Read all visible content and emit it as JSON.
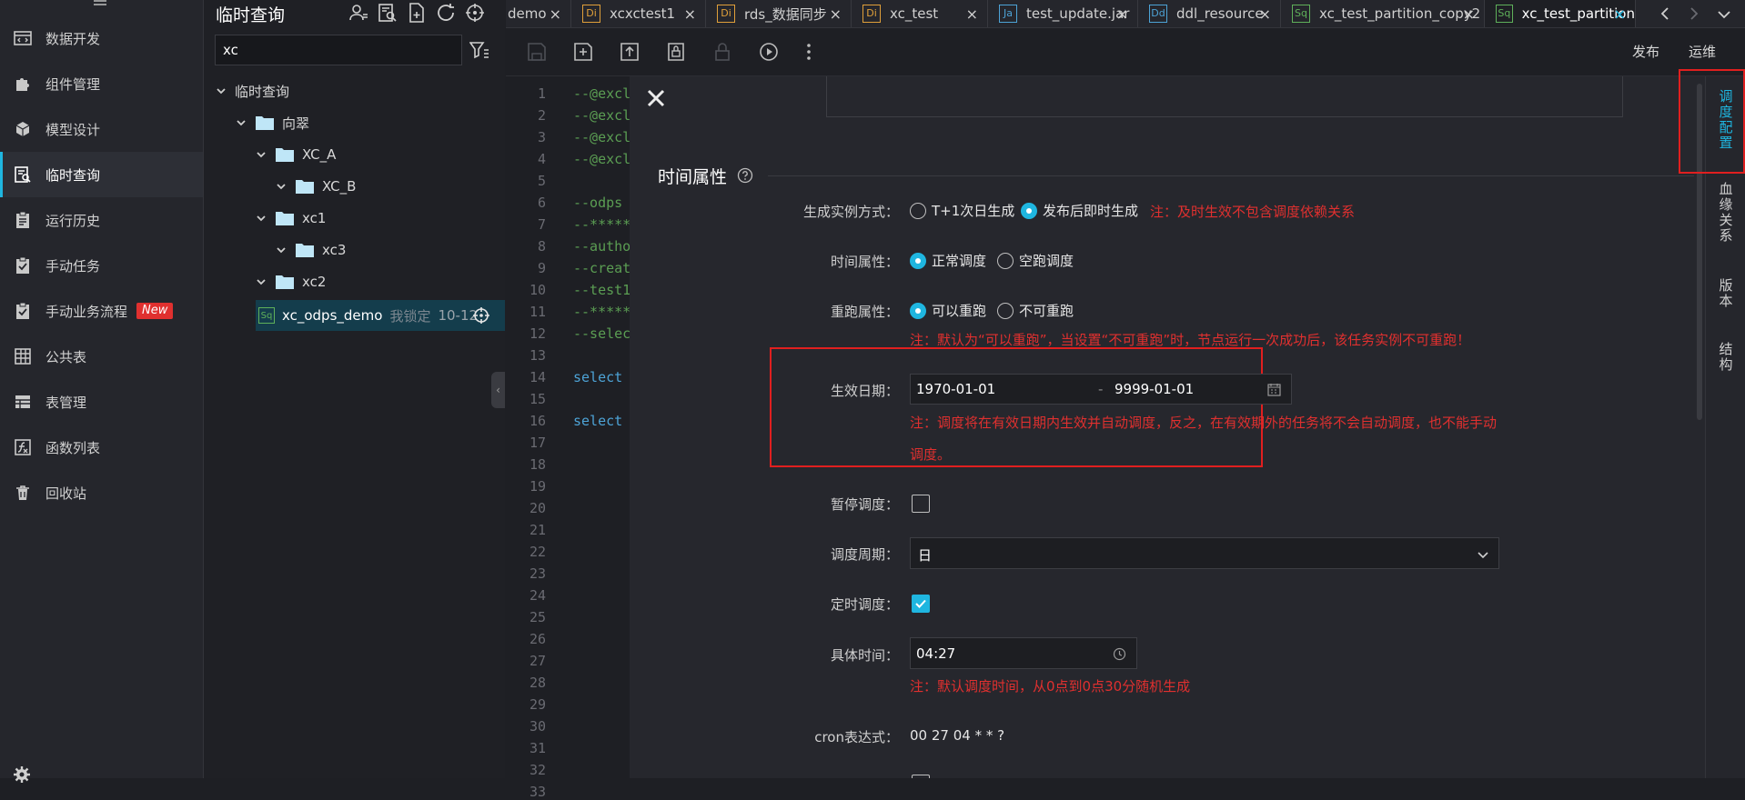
{
  "nav": {
    "items": [
      {
        "label": "数据开发",
        "icon": "code-window-icon"
      },
      {
        "label": "组件管理",
        "icon": "puzzle-icon"
      },
      {
        "label": "模型设计",
        "icon": "cube-icon"
      },
      {
        "label": "临时查询",
        "icon": "query-doc-icon"
      },
      {
        "label": "运行历史",
        "icon": "clipboard-icon"
      },
      {
        "label": "手动任务",
        "icon": "clipboard-check-icon"
      },
      {
        "label": "手动业务流程",
        "icon": "clipboard-check-icon",
        "badge": "New"
      },
      {
        "label": "公共表",
        "icon": "table-grid-icon"
      },
      {
        "label": "表管理",
        "icon": "table-list-icon"
      },
      {
        "label": "函数列表",
        "icon": "function-icon"
      },
      {
        "label": "回收站",
        "icon": "trash-icon"
      }
    ],
    "active_index": 3
  },
  "tree": {
    "title": "临时查询",
    "search_value": "xc",
    "root": "临时查询",
    "nodes": [
      {
        "label": "向翠"
      },
      {
        "label": "XC_A"
      },
      {
        "label": "XC_B"
      },
      {
        "label": "xc1"
      },
      {
        "label": "xc3"
      },
      {
        "label": "xc2"
      }
    ],
    "selected": {
      "type_badge": "Sq",
      "label": "xc_odps_demo",
      "locked": "我锁定",
      "date": "10-12"
    }
  },
  "tabs": [
    {
      "label": "demo",
      "badge": ""
    },
    {
      "label": "xcxctest1",
      "badge": "Di"
    },
    {
      "label": "rds_数据同步",
      "badge": "Di"
    },
    {
      "label": "xc_test",
      "badge": "Di"
    },
    {
      "label": "test_update.jar",
      "badge": "Ja"
    },
    {
      "label": "ddl_resource",
      "badge": "Dd"
    },
    {
      "label": "xc_test_partition_copy2",
      "badge": "Sq"
    },
    {
      "label": "xc_test_partition",
      "badge": "Sq"
    }
  ],
  "toolbar": {
    "publish": "发布",
    "ops": "运维"
  },
  "editor": {
    "line_numbers": [
      "1",
      "2",
      "3",
      "4",
      "5",
      "6",
      "7",
      "8",
      "9",
      "10",
      "11",
      "12",
      "13",
      "14",
      "15",
      "16",
      "17",
      "18",
      "19",
      "20",
      "21",
      "22",
      "23",
      "24",
      "25",
      "26",
      "27",
      "28",
      "29",
      "30",
      "31",
      "32",
      "33"
    ],
    "lines": [
      {
        "n": 1,
        "text": "--@excl",
        "kind": "cmt"
      },
      {
        "n": 2,
        "text": "--@excl",
        "kind": "cmt"
      },
      {
        "n": 3,
        "text": "--@excl",
        "kind": "cmt"
      },
      {
        "n": 4,
        "text": "--@excl",
        "kind": "cmt"
      },
      {
        "n": 6,
        "text": "--odps ",
        "kind": "cmt"
      },
      {
        "n": 7,
        "text": "--*****",
        "kind": "cmt"
      },
      {
        "n": 8,
        "text": "--autho",
        "kind": "cmt"
      },
      {
        "n": 9,
        "text": "--creat",
        "kind": "cmt"
      },
      {
        "n": 10,
        "text": "--test1",
        "kind": "cmt"
      },
      {
        "n": 11,
        "text": "--*****",
        "kind": "cmt"
      },
      {
        "n": 12,
        "text": "--selec",
        "kind": "cmt"
      },
      {
        "n": 14,
        "text": "select",
        "kind": "kw"
      },
      {
        "n": 16,
        "text": "select",
        "kind": "kw"
      }
    ]
  },
  "config": {
    "section_title": "时间属性",
    "instance_mode": {
      "label": "生成实例方式：",
      "opt1": "T+1次日生成",
      "opt2": "发布后即时生成",
      "note": "注：及时生效不包含调度依赖关系"
    },
    "time_attr": {
      "label": "时间属性：",
      "opt1": "正常调度",
      "opt2": "空跑调度"
    },
    "rerun": {
      "label": "重跑属性：",
      "opt1": "可以重跑",
      "opt2": "不可重跑",
      "note": "注：默认为“可以重跑”，当设置“不可重跑”时，节点运行一次成功后，该任务实例不可重跑！"
    },
    "effective_date": {
      "label": "生效日期：",
      "start": "1970-01-01",
      "sep": "-",
      "end": "9999-01-01",
      "note1": "注：调度将在有效日期内生效并自动调度，反之，在有效期外的任务将不会自动调度，也不能手动",
      "note2": "调度。"
    },
    "pause": {
      "label": "暂停调度："
    },
    "cycle": {
      "label": "调度周期：",
      "value": "日"
    },
    "timed": {
      "label": "定时调度："
    },
    "time": {
      "label": "具体时间：",
      "value": "04:27",
      "note": "注：默认调度时间，从0点到0点30分随机生成"
    },
    "cron": {
      "label": "cron表达式：",
      "value": "00 27 04 * * ?"
    }
  },
  "right_tabs": [
    {
      "label": "调度配置"
    },
    {
      "label": "血缘关系"
    },
    {
      "label": "版本"
    },
    {
      "label": "结构"
    }
  ],
  "colors": {
    "accent": "#1fb6e0",
    "note_red": "#e0302f",
    "highlight_box": "#e01f1f"
  }
}
